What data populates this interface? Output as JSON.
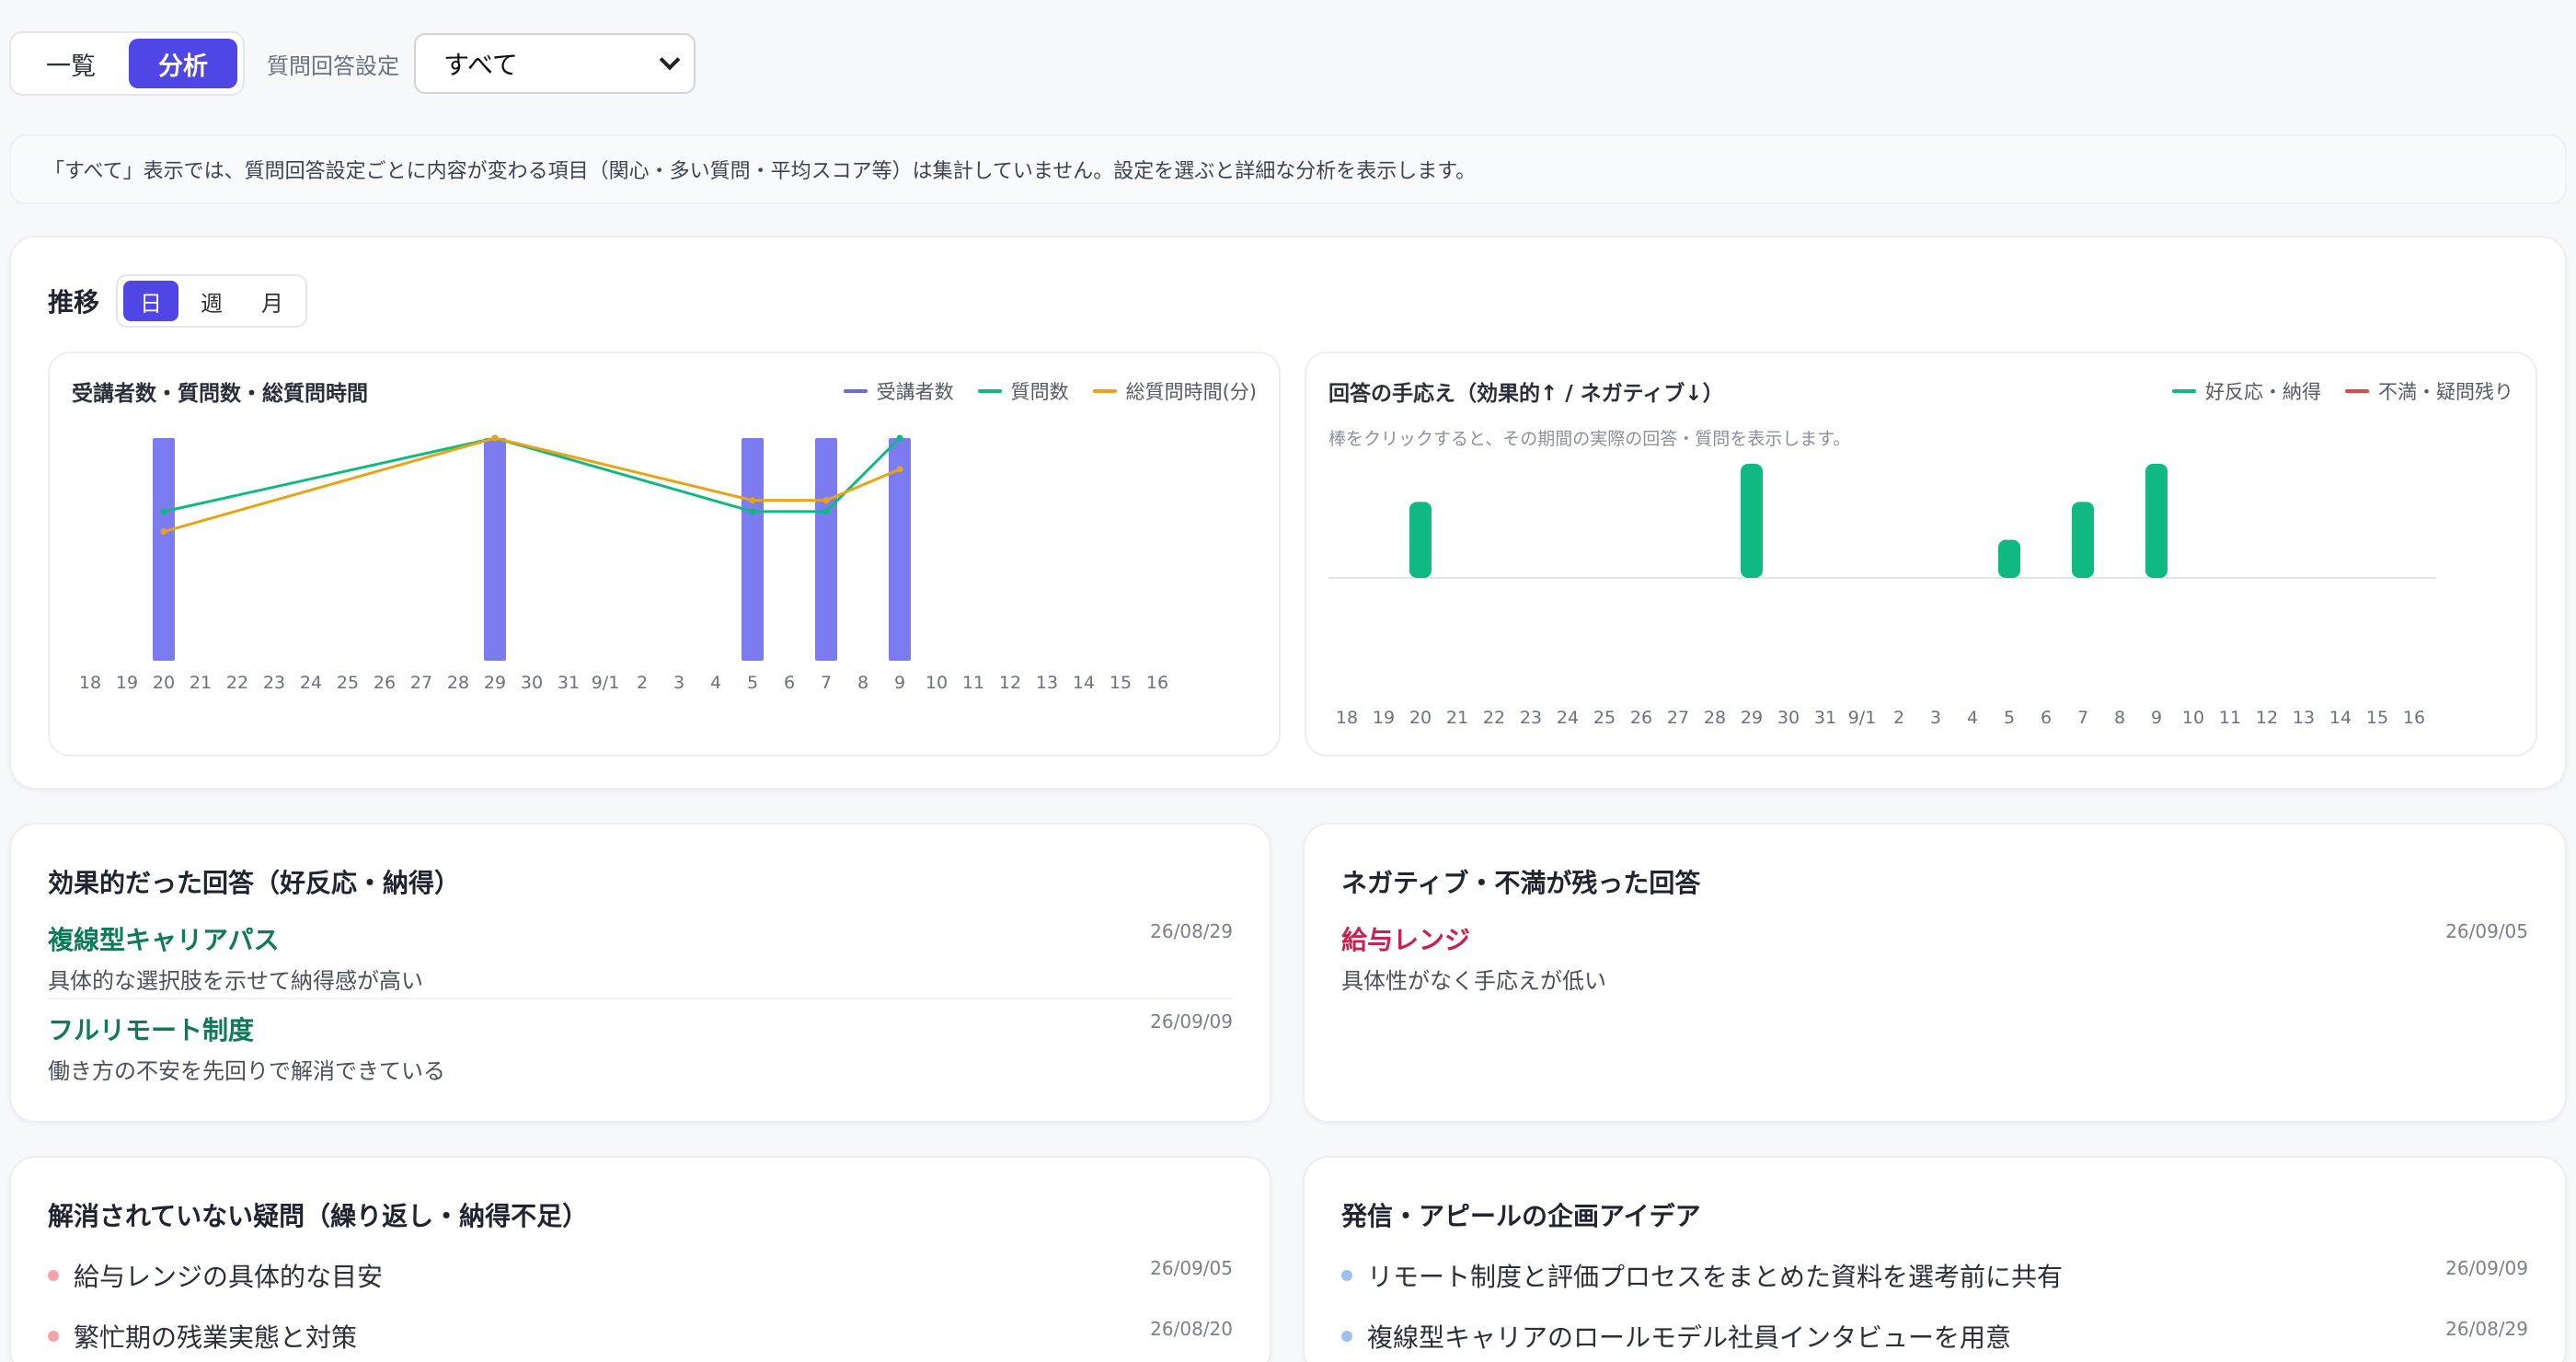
{
  "toolbar": {
    "tabs": [
      {
        "label": "一覧",
        "active": false
      },
      {
        "label": "分析",
        "active": true
      }
    ],
    "filter_label": "質問回答設定",
    "filter_value": "すべて"
  },
  "notice": "「すべて」表示では、質問回答設定ごとに内容が変わる項目（関心・多い質問・平均スコア等）は集計していません。設定を選ぶと詳細な分析を表示します。",
  "trend": {
    "title": "推移",
    "periods": [
      {
        "label": "日",
        "active": true
      },
      {
        "label": "週",
        "active": false
      },
      {
        "label": "月",
        "active": false
      }
    ]
  },
  "colors": {
    "accent": "#4f46e5",
    "bar_purple": "#7c7cf0",
    "green": "#10b981",
    "orange": "#e8a317",
    "red": "#e04848"
  },
  "chart_data": [
    {
      "type": "bar",
      "title": "受講者数・質問数・総質問時間",
      "categories": [
        "18",
        "19",
        "20",
        "21",
        "22",
        "23",
        "24",
        "25",
        "26",
        "27",
        "28",
        "29",
        "30",
        "31",
        "9/1",
        "2",
        "3",
        "4",
        "5",
        "6",
        "7",
        "8",
        "9",
        "10",
        "11",
        "12",
        "13",
        "14",
        "15",
        "16"
      ],
      "series": [
        {
          "name": "受講者数",
          "kind": "bar",
          "values": [
            0,
            0,
            1,
            0,
            0,
            0,
            0,
            0,
            0,
            0,
            0,
            1,
            0,
            0,
            0,
            0,
            0,
            0,
            1,
            0,
            1,
            0,
            1,
            0,
            0,
            0,
            0,
            0,
            0,
            0
          ]
        },
        {
          "name": "質問数",
          "kind": "line",
          "points": [
            {
              "x": "20",
              "y": 0.67
            },
            {
              "x": "29",
              "y": 1.0
            },
            {
              "x": "5",
              "y": 0.67
            },
            {
              "x": "7",
              "y": 0.67
            },
            {
              "x": "9",
              "y": 1.0
            }
          ]
        },
        {
          "name": "総質問時間(分)",
          "kind": "line",
          "points": [
            {
              "x": "20",
              "y": 0.58
            },
            {
              "x": "29",
              "y": 1.0
            },
            {
              "x": "5",
              "y": 0.72
            },
            {
              "x": "7",
              "y": 0.72
            },
            {
              "x": "9",
              "y": 0.86
            }
          ]
        }
      ],
      "ylim": [
        0,
        1
      ],
      "grid": false,
      "legend": "top-right"
    },
    {
      "type": "bar",
      "title": "回答の手応え（効果的↑ / ネガティブ↓）",
      "hint": "棒をクリックすると、その期間の実際の回答・質問を表示します。",
      "categories": [
        "18",
        "19",
        "20",
        "21",
        "22",
        "23",
        "24",
        "25",
        "26",
        "27",
        "28",
        "29",
        "30",
        "31",
        "9/1",
        "2",
        "3",
        "4",
        "5",
        "6",
        "7",
        "8",
        "9",
        "10",
        "11",
        "12",
        "13",
        "14",
        "15",
        "16"
      ],
      "series": [
        {
          "name": "好反応・納得",
          "values": [
            0,
            0,
            2,
            0,
            0,
            0,
            0,
            0,
            0,
            0,
            0,
            3,
            0,
            0,
            0,
            0,
            0,
            0,
            1,
            0,
            2,
            0,
            3,
            0,
            0,
            0,
            0,
            0,
            0,
            0
          ]
        },
        {
          "name": "不満・疑問残り",
          "values": [
            0,
            0,
            0,
            0,
            0,
            0,
            0,
            0,
            0,
            0,
            0,
            0,
            0,
            0,
            0,
            0,
            0,
            0,
            0,
            0,
            0,
            0,
            0,
            0,
            0,
            0,
            0,
            0,
            0,
            0
          ]
        }
      ],
      "ylim": [
        -3,
        3
      ],
      "legend": "top-right"
    }
  ],
  "effective": {
    "title": "効果的だった回答（好反応・納得）",
    "items": [
      {
        "title": "複線型キャリアパス",
        "sub": "具体的な選択肢を示せて納得感が高い",
        "date": "26/08/29"
      },
      {
        "title": "フルリモート制度",
        "sub": "働き方の不安を先回りで解消できている",
        "date": "26/09/09"
      }
    ]
  },
  "negative": {
    "title": "ネガティブ・不満が残った回答",
    "items": [
      {
        "title": "給与レンジ",
        "sub": "具体性がなく手応えが低い",
        "date": "26/09/05"
      }
    ]
  },
  "unresolved": {
    "title": "解消されていない疑問（繰り返し・納得不足）",
    "items": [
      {
        "text": "給与レンジの具体的な目安",
        "date": "26/09/05"
      },
      {
        "text": "繁忙期の残業実態と対策",
        "date": "26/08/20"
      }
    ]
  },
  "ideas": {
    "title": "発信・アピールの企画アイデア",
    "items": [
      {
        "text": "リモート制度と評価プロセスをまとめた資料を選考前に共有",
        "date": "26/09/09"
      },
      {
        "text": "複線型キャリアのロールモデル社員インタビューを用意",
        "date": "26/08/29"
      }
    ]
  }
}
